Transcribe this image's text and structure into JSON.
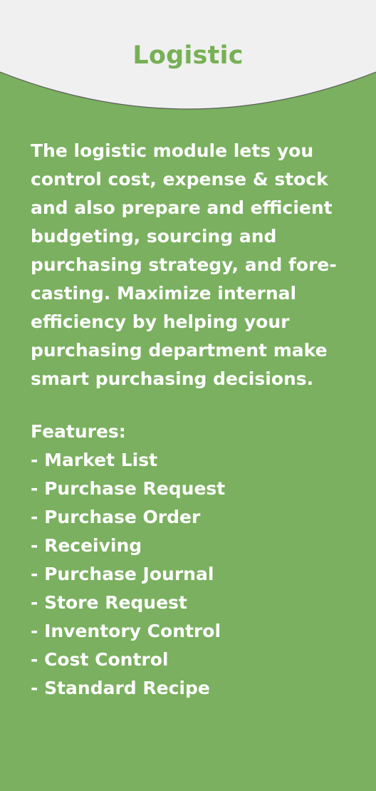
{
  "title": "Logistic",
  "description_lines": [
    "The logistic module lets you",
    "control cost, expense & stock",
    "and also prepare and efficient",
    "budgeting, sourcing and",
    "purchasing strategy, and fore-",
    "casting. Maximize internal",
    "efficiency by helping your",
    "purchasing department make",
    "smart purchasing decisions."
  ],
  "features": {
    "heading": "Features:",
    "items": [
      "- Market List",
      "- Purchase Request",
      "- Purchase Order",
      "- Receiving",
      "- Purchase Journal",
      "- Store Request",
      "- Inventory Control",
      "- Cost Control",
      "- Standard Recipe"
    ]
  },
  "colors": {
    "background_green": "#7ab05f",
    "header_gray": "#f0f0f0",
    "title_green": "#77b055",
    "text_white": "#ffffff"
  }
}
